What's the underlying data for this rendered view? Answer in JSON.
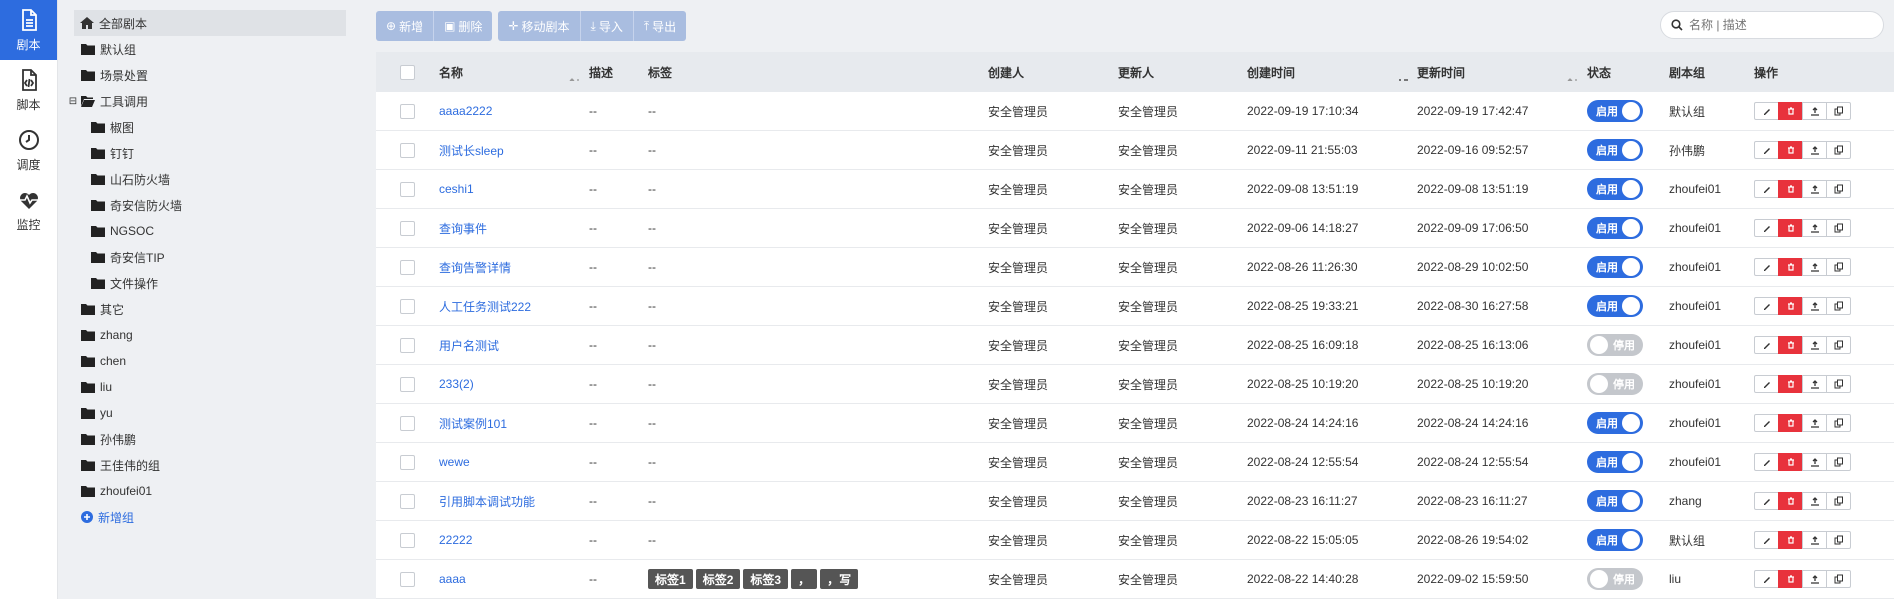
{
  "nav": [
    {
      "label": "剧本",
      "icon": "document-icon",
      "active": true
    },
    {
      "label": "脚本",
      "icon": "code-file-icon",
      "active": false
    },
    {
      "label": "调度",
      "icon": "clock-icon",
      "active": false
    },
    {
      "label": "监控",
      "icon": "heartbeat-icon",
      "active": false
    }
  ],
  "tree": {
    "root": "全部剧本",
    "groups": [
      "默认组",
      "场景处置"
    ],
    "tools_group": "工具调用",
    "tools_children": [
      "椒图",
      "钉钉",
      "山石防火墙",
      "奇安信防火墙",
      "NGSOC",
      "奇安信TIP",
      "文件操作"
    ],
    "other_groups": [
      "其它",
      "zhang",
      "chen",
      "liu",
      "yu",
      "孙伟鹏",
      "王佳伟的组",
      "zhoufei01"
    ],
    "add_group": "新增组"
  },
  "toolbar": {
    "add": "新增",
    "delete": "删除",
    "move": "移动剧本",
    "import": "导入",
    "export": "导出"
  },
  "search": {
    "placeholder": "名称 | 描述"
  },
  "columns": {
    "name": "名称",
    "desc": "描述",
    "tags": "标签",
    "creator": "创建人",
    "updater": "更新人",
    "ctime": "创建时间",
    "utime": "更新时间",
    "status": "状态",
    "group": "剧本组",
    "ops": "操作"
  },
  "status_labels": {
    "on": "启用",
    "off": "停用"
  },
  "rows": [
    {
      "name": "aaaa2222",
      "desc": "--",
      "tags": "--",
      "creator": "安全管理员",
      "updater": "安全管理员",
      "ctime": "2022-09-19 17:10:34",
      "utime": "2022-09-19 17:42:47",
      "enabled": true,
      "group": "默认组"
    },
    {
      "name": "测试长sleep",
      "desc": "--",
      "tags": "--",
      "creator": "安全管理员",
      "updater": "安全管理员",
      "ctime": "2022-09-11 21:55:03",
      "utime": "2022-09-16 09:52:57",
      "enabled": true,
      "group": "孙伟鹏"
    },
    {
      "name": "ceshi1",
      "desc": "--",
      "tags": "--",
      "creator": "安全管理员",
      "updater": "安全管理员",
      "ctime": "2022-09-08 13:51:19",
      "utime": "2022-09-08 13:51:19",
      "enabled": true,
      "group": "zhoufei01"
    },
    {
      "name": "查询事件",
      "desc": "--",
      "tags": "--",
      "creator": "安全管理员",
      "updater": "安全管理员",
      "ctime": "2022-09-06 14:18:27",
      "utime": "2022-09-09 17:06:50",
      "enabled": true,
      "group": "zhoufei01"
    },
    {
      "name": "查询告警详情",
      "desc": "--",
      "tags": "--",
      "creator": "安全管理员",
      "updater": "安全管理员",
      "ctime": "2022-08-26 11:26:30",
      "utime": "2022-08-29 10:02:50",
      "enabled": true,
      "group": "zhoufei01"
    },
    {
      "name": "人工任务测试222",
      "desc": "--",
      "tags": "--",
      "creator": "安全管理员",
      "updater": "安全管理员",
      "ctime": "2022-08-25 19:33:21",
      "utime": "2022-08-30 16:27:58",
      "enabled": true,
      "group": "zhoufei01"
    },
    {
      "name": "用户名测试",
      "desc": "--",
      "tags": "--",
      "creator": "安全管理员",
      "updater": "安全管理员",
      "ctime": "2022-08-25 16:09:18",
      "utime": "2022-08-25 16:13:06",
      "enabled": false,
      "group": "zhoufei01"
    },
    {
      "name": "233(2)",
      "desc": "--",
      "tags": "--",
      "creator": "安全管理员",
      "updater": "安全管理员",
      "ctime": "2022-08-25 10:19:20",
      "utime": "2022-08-25 10:19:20",
      "enabled": false,
      "group": "zhoufei01"
    },
    {
      "name": "测试案例101",
      "desc": "--",
      "tags": "--",
      "creator": "安全管理员",
      "updater": "安全管理员",
      "ctime": "2022-08-24 14:24:16",
      "utime": "2022-08-24 14:24:16",
      "enabled": true,
      "group": "zhoufei01"
    },
    {
      "name": "wewe",
      "desc": "--",
      "tags": "--",
      "creator": "安全管理员",
      "updater": "安全管理员",
      "ctime": "2022-08-24 12:55:54",
      "utime": "2022-08-24 12:55:54",
      "enabled": true,
      "group": "zhoufei01"
    },
    {
      "name": "引用脚本调试功能",
      "desc": "--",
      "tags": "--",
      "creator": "安全管理员",
      "updater": "安全管理员",
      "ctime": "2022-08-23 16:11:27",
      "utime": "2022-08-23 16:11:27",
      "enabled": true,
      "group": "zhang"
    },
    {
      "name": "22222",
      "desc": "--",
      "tags": "--",
      "creator": "安全管理员",
      "updater": "安全管理员",
      "ctime": "2022-08-22 15:05:05",
      "utime": "2022-08-26 19:54:02",
      "enabled": true,
      "group": "默认组"
    },
    {
      "name": "aaaa",
      "desc": "--",
      "tag_list": [
        "标签1",
        "标签2",
        "标签3",
        "，",
        "，写"
      ],
      "creator": "安全管理员",
      "updater": "安全管理员",
      "ctime": "2022-08-22 14:40:28",
      "utime": "2022-09-02 15:59:50",
      "enabled": false,
      "group": "liu"
    }
  ],
  "colors": {
    "primary": "#2d6cdf",
    "danger": "#e8323c",
    "toolbar_button": "#a9bde0"
  }
}
